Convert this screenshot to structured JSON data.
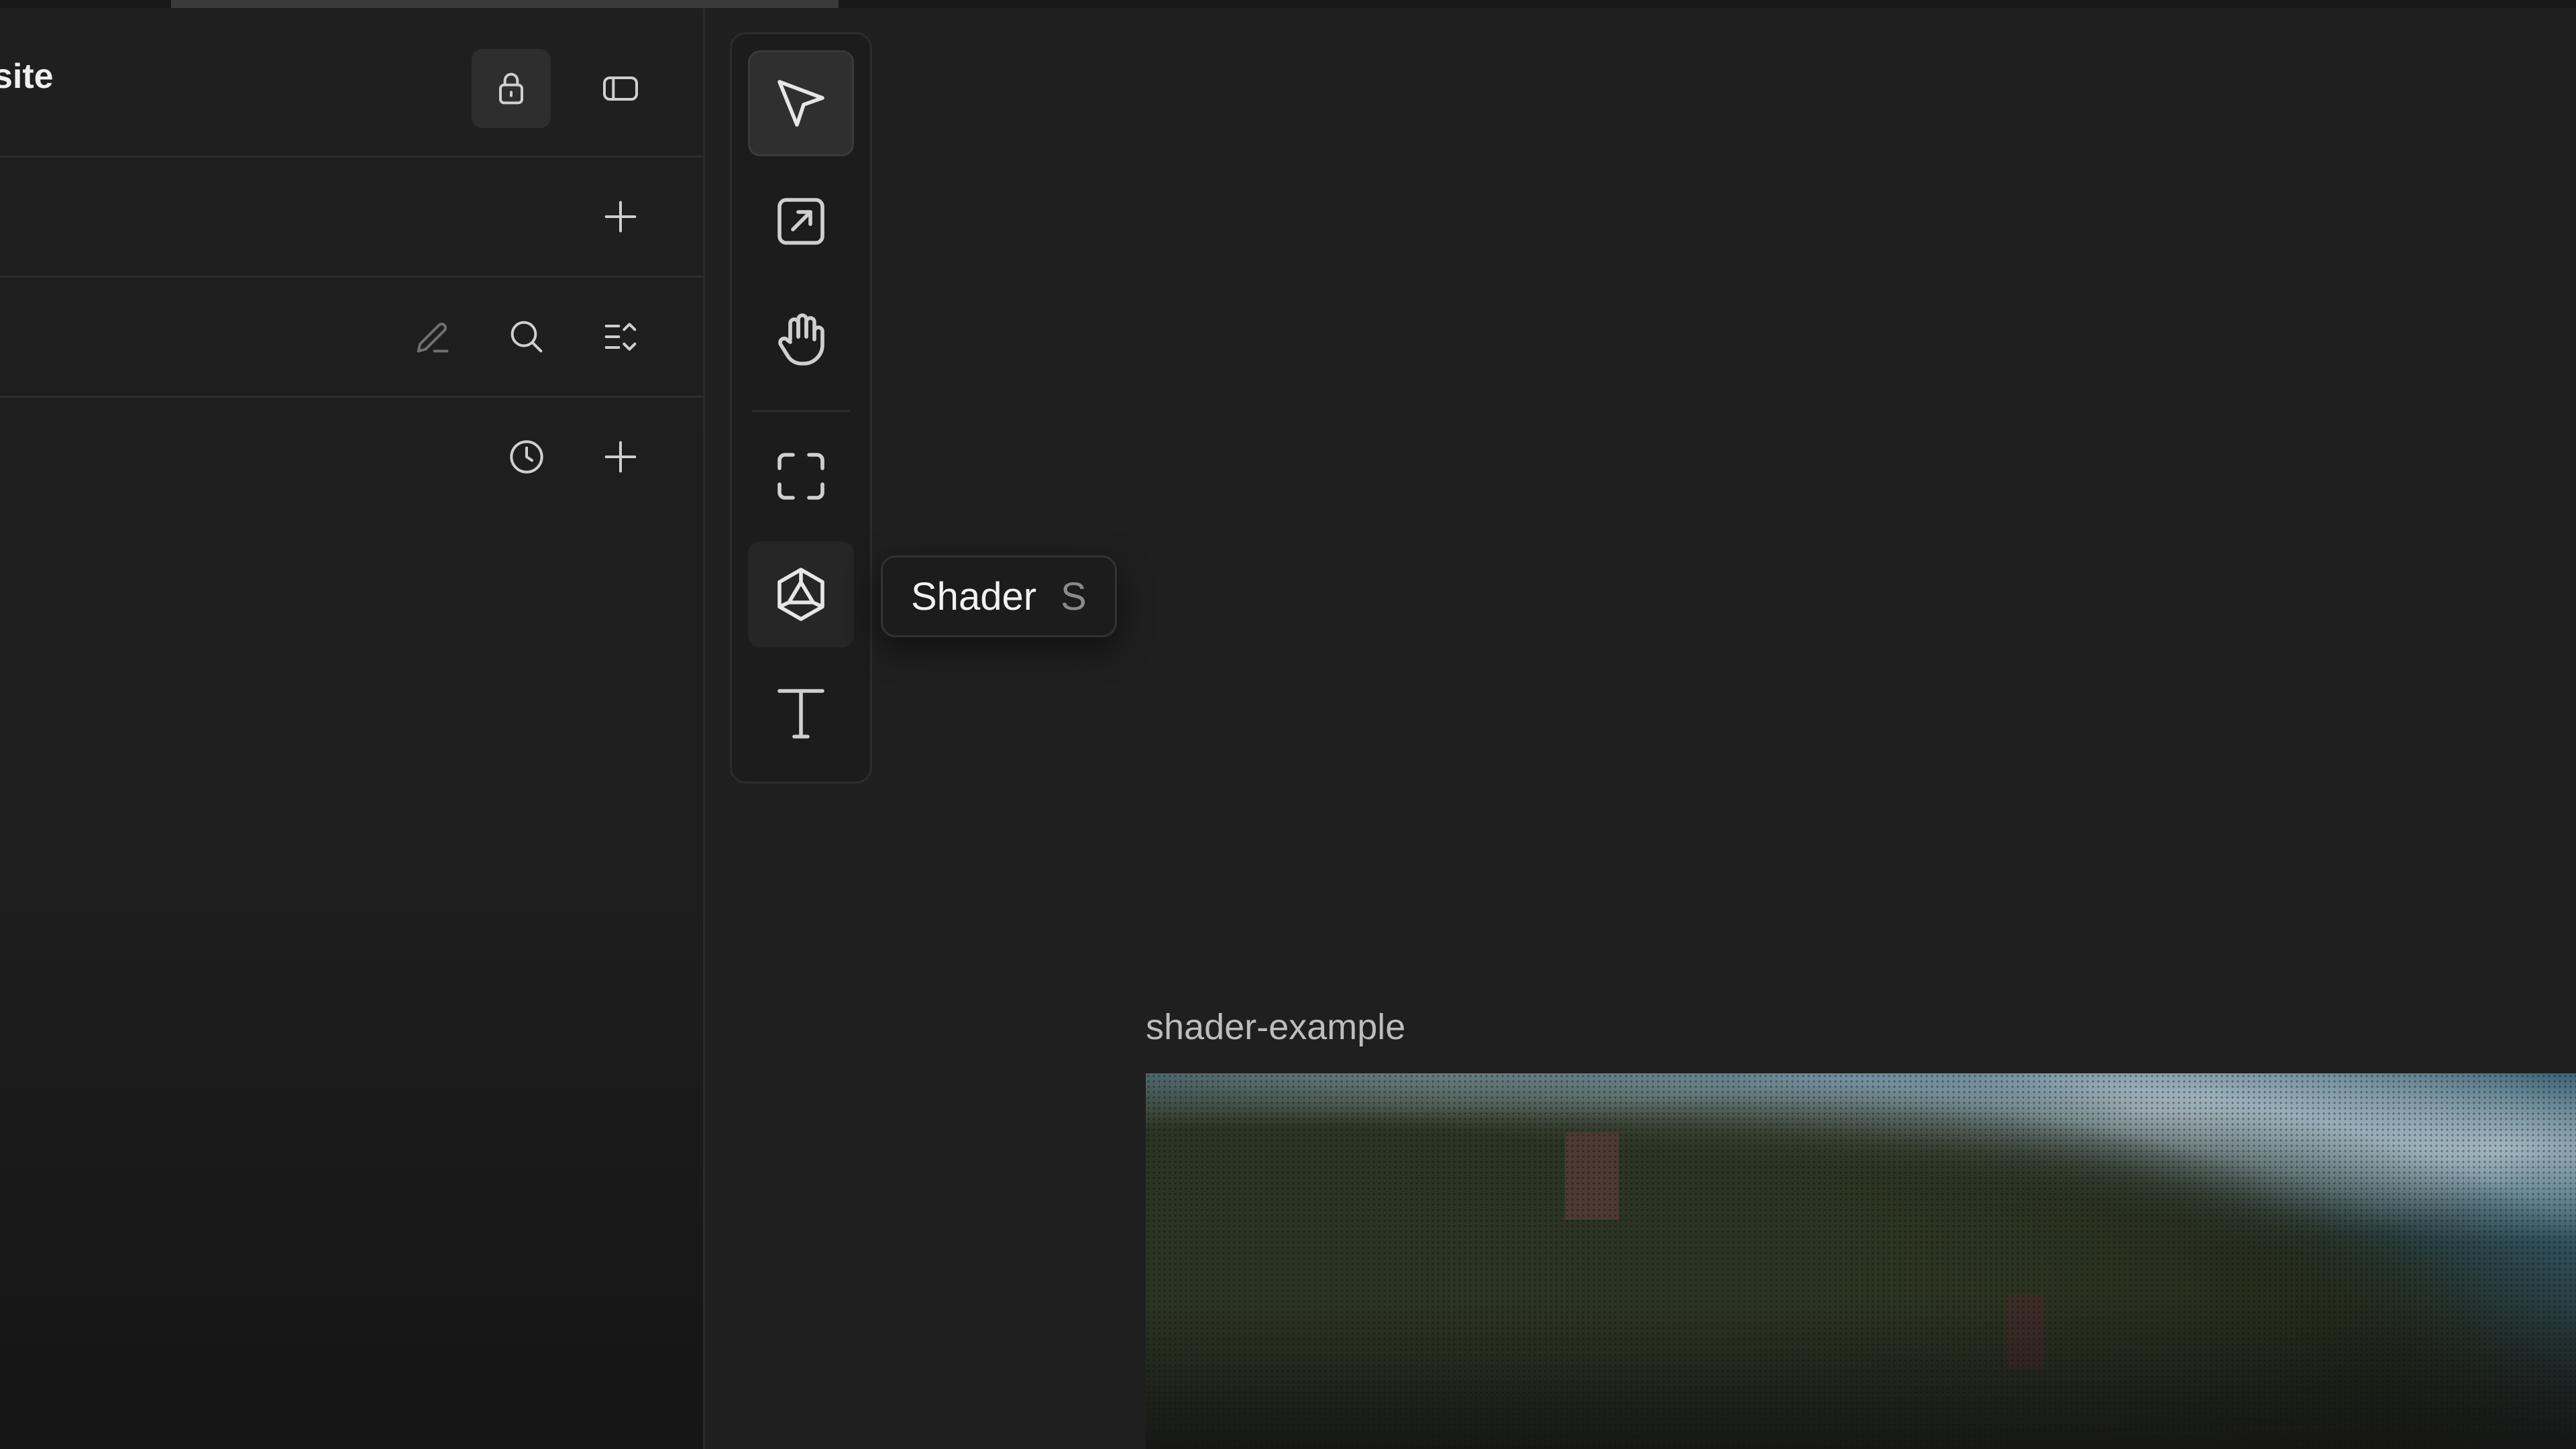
{
  "project": {
    "title": "site"
  },
  "toolbar_tools": [
    {
      "name": "select-tool",
      "icon": "pointer-icon"
    },
    {
      "name": "export-tool",
      "icon": "external-link-icon"
    },
    {
      "name": "hand-tool",
      "icon": "hand-icon"
    },
    {
      "name": "frame-tool",
      "icon": "frame-icon"
    },
    {
      "name": "shader-tool",
      "icon": "shader-icon"
    },
    {
      "name": "text-tool",
      "icon": "text-icon"
    }
  ],
  "tooltip": {
    "label": "Shader",
    "shortcut": "S"
  },
  "canvas": {
    "frame_label": "shader-example"
  },
  "colors": {
    "background": "#1f1f1f",
    "panel_border": "#2c2c2c",
    "icon": "#cfcfcf",
    "icon_muted": "#6f6f6f"
  }
}
